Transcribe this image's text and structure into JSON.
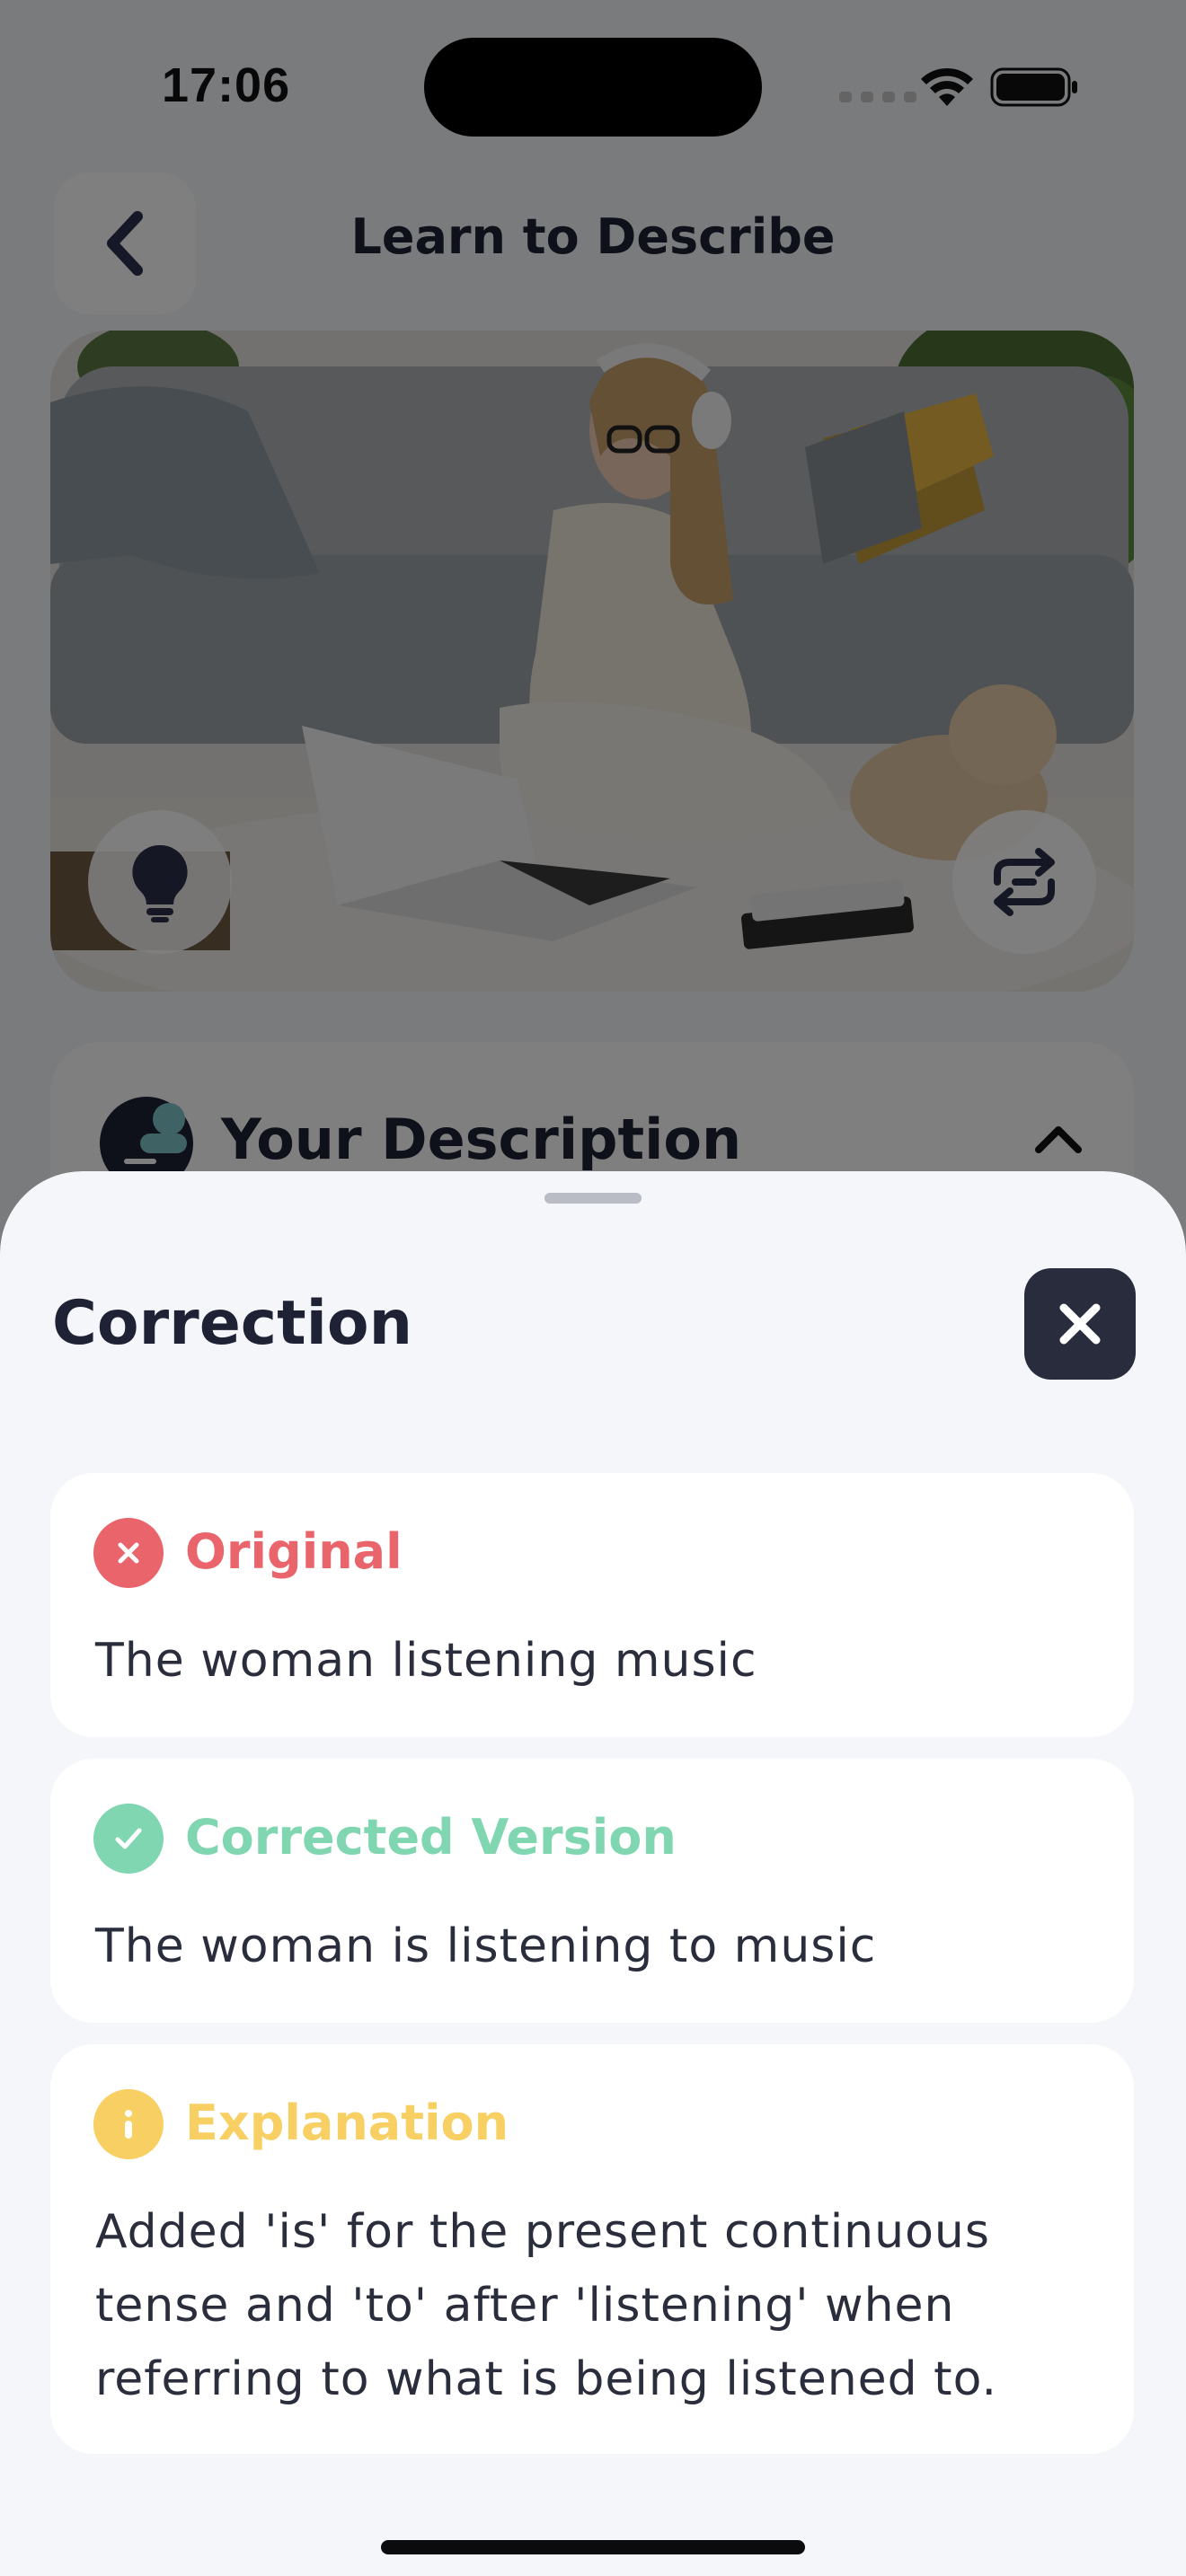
{
  "status_bar": {
    "time": "17:06"
  },
  "header": {
    "title": "Learn to Describe"
  },
  "description_card": {
    "title": "Your Description"
  },
  "sheet": {
    "title": "Correction",
    "original": {
      "heading": "Original",
      "text": "The woman listening music",
      "color": "#e9646b"
    },
    "corrected": {
      "heading": "Corrected Version",
      "text": "The woman is listening to music",
      "color": "#7fd6b1"
    },
    "explanation": {
      "heading": "Explanation",
      "text": "Added 'is' for the present continuous tense and 'to' after 'listening' when referring to what is being listened to.",
      "color": "#f7cf62"
    }
  },
  "icons": {
    "back": "chevron-left-icon",
    "hint": "lightbulb-icon",
    "swap": "swap-icon",
    "close": "close-icon",
    "original_badge": "x-circle-icon",
    "corrected_badge": "check-circle-icon",
    "explanation_badge": "info-circle-icon"
  }
}
